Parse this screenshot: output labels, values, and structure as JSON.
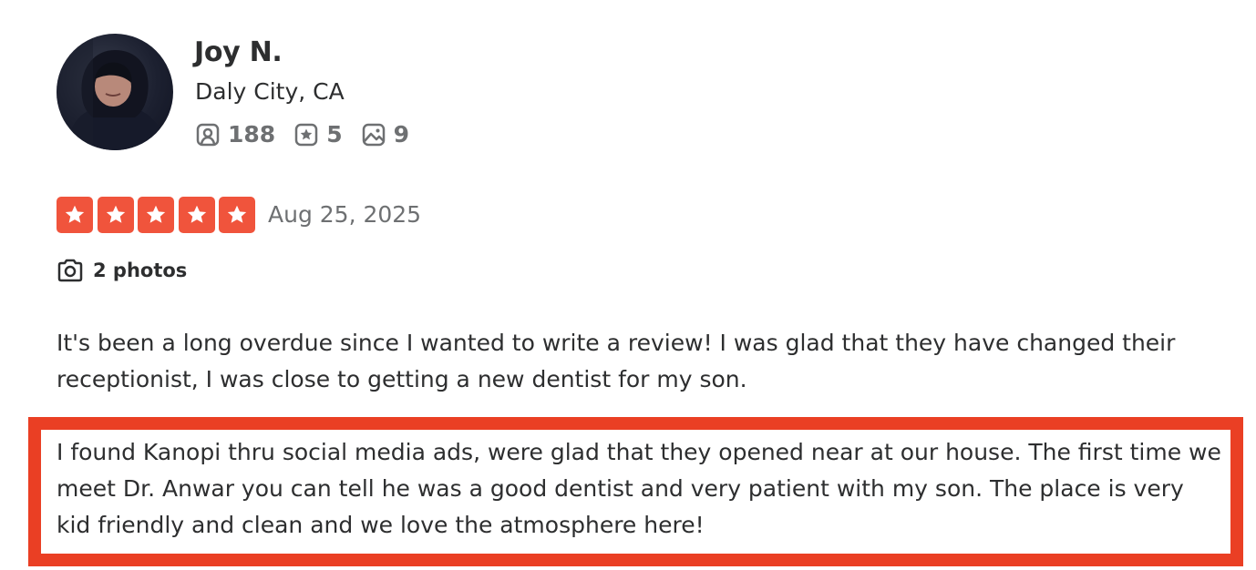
{
  "reviewer": {
    "name": "Joy N.",
    "location": "Daly City, CA",
    "stats": {
      "friends": "188",
      "reviews": "5",
      "photos": "9"
    }
  },
  "review": {
    "rating": 5,
    "rating_max": 5,
    "date": "Aug 25, 2025",
    "photos_label": "2 photos",
    "paragraph_1": "It's been a long overdue since I wanted to write a review! I was glad that they have changed their receptionist, I was close to getting a new dentist for my son.",
    "paragraph_2": "I found Kanopi thru social media ads, were glad that they opened near at our house. The first time we meet Dr. Anwar you can tell he was a good dentist and very patient with my son. The place is very kid friendly and clean and we love the atmosphere here!"
  },
  "colors": {
    "star_red": "#f0543c",
    "highlight_border": "#ea3f24",
    "text_dark": "#2d2e2f",
    "text_muted": "#6e7072"
  },
  "icons": {
    "friends": "friends-icon",
    "reviews": "star-badge-icon",
    "photos": "image-icon",
    "camera": "camera-icon"
  }
}
